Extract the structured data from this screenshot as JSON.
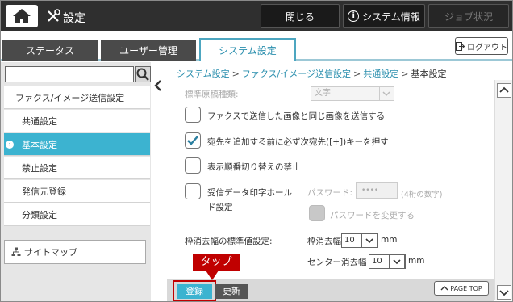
{
  "header": {
    "title": "設定",
    "close_label": "閉じる",
    "sysinfo_label": "システム情報",
    "job_label": "ジョブ状況"
  },
  "tabs": {
    "status": "ステータス",
    "user": "ユーザー管理",
    "system": "システム設定",
    "logout": "ログアウト"
  },
  "sidebar": {
    "search_placeholder": "",
    "category": "ファクス/イメージ送信設定",
    "items": [
      "共通設定",
      "基本設定",
      "禁止設定",
      "発信元登録",
      "分類設定"
    ],
    "sitemap": "サイトマップ"
  },
  "breadcrumb": {
    "b1": "システム設定",
    "b2": "ファクス/イメージ送信設定",
    "b3": "共通設定",
    "b4": "基本設定",
    "sep": ">"
  },
  "form": {
    "orig_type_label": "標準原稿種類:",
    "orig_type_value": "文字",
    "opt1": "ファクスで送信した画像と同じ画像を送信する",
    "opt2": "宛先を追加する前に必ず次宛先([+])キーを押す",
    "opt3": "表示順番切り替えの禁止",
    "opt4_line1": "受信データ印字ホール",
    "opt4_line2": "ド設定",
    "password_label": "パスワード:",
    "password_value": "••••",
    "password_hint": "(4桁の数字)",
    "change_pw": "パスワードを変更する",
    "erase_label": "枠消去幅の標準値設定:",
    "frame_erase_label": "枠消去幅",
    "frame_erase_value": "10",
    "center_erase_label": "センター消去幅",
    "center_erase_value": "10",
    "unit": "mm"
  },
  "footer": {
    "register": "登録",
    "update": "更新",
    "page_top": "PAGE TOP"
  },
  "annotation": {
    "callout": "タップ"
  },
  "colors": {
    "accent": "#3cb3d0",
    "header_bg": "#2f2f2f",
    "callout": "#c00000"
  }
}
